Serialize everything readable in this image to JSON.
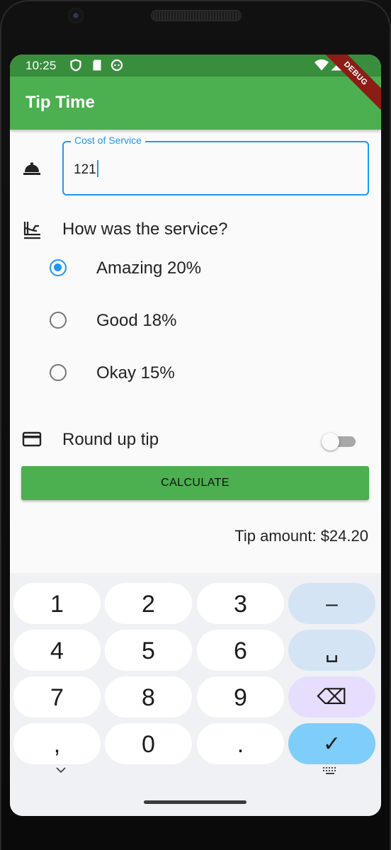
{
  "status_bar": {
    "time": "10:25",
    "debug_banner": "DEBUG"
  },
  "app_bar": {
    "title": "Tip Time"
  },
  "cost_field": {
    "label": "Cost of Service",
    "value": "121"
  },
  "service_question": "How was the service?",
  "tip_options": [
    {
      "label": "Amazing 20%",
      "selected": true
    },
    {
      "label": "Good 18%",
      "selected": false
    },
    {
      "label": "Okay 15%",
      "selected": false
    }
  ],
  "round_up": {
    "label": "Round up tip",
    "enabled": false
  },
  "calculate_button": "CALCULATE",
  "tip_amount": "Tip amount: $24.20",
  "keyboard": {
    "row1": [
      "1",
      "2",
      "3",
      "–"
    ],
    "row2": [
      "4",
      "5",
      "6",
      "␣"
    ],
    "row3": [
      "7",
      "8",
      "9",
      "⌫"
    ],
    "row4": [
      ",",
      "0",
      ".",
      "✓"
    ]
  },
  "colors": {
    "primary": "#4caf50",
    "primary_dark": "#388e3c",
    "accent": "#2196f3"
  }
}
